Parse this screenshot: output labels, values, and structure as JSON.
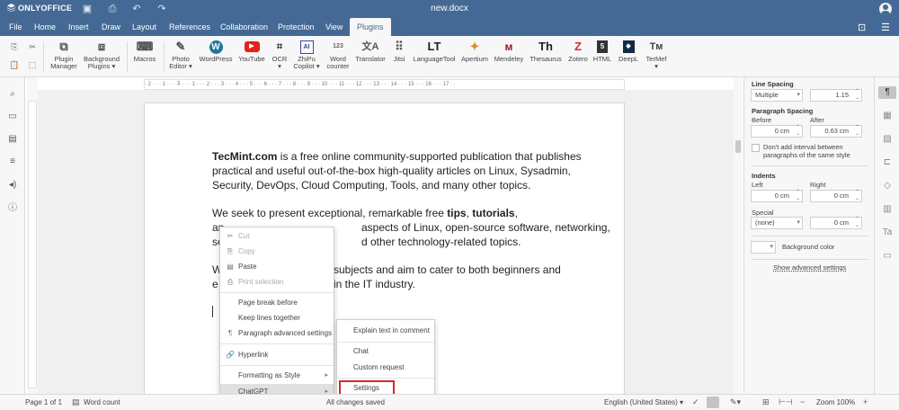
{
  "app": {
    "logo_text": "ONLYOFFICE",
    "doc_title": "new.docx"
  },
  "menu_tabs": [
    "File",
    "Home",
    "Insert",
    "Draw",
    "Layout",
    "References",
    "Collaboration",
    "Protection",
    "View",
    "Plugins"
  ],
  "active_tab": "Plugins",
  "toolbar": {
    "plugin_manager": "Plugin\nManager",
    "plugin_manager_l1": "Plugin",
    "plugin_manager_l2": "Manager",
    "background_plugins_l1": "Background",
    "background_plugins_l2": "Plugins ▾",
    "macros": "Macros",
    "photo_editor_l1": "Photo",
    "photo_editor_l2": "Editor ▾",
    "wordpress": "WordPress",
    "youtube": "YouTube",
    "ocr_l1": "OCR",
    "ocr_l2": "▾",
    "zhipu_l1": "ZhiPu",
    "zhipu_l2": "Copilot ▾",
    "word_counter_l1": "Word",
    "word_counter_l2": "counter",
    "translator": "Translator",
    "jitsi": "Jitsi",
    "languagetool": "LanguageTool",
    "apertium": "Apertium",
    "mendeley": "Mendeley",
    "thesaurus": "Thesaurus",
    "zotero": "Zotero",
    "html": "HTML",
    "deepl": "DeepL",
    "termef_l1": "TerMef",
    "termef_l2": "▾"
  },
  "ruler_text": "· 2 · · · 1 · · · ⊼ · · · 1 · · · 2 · · · 3 · · · 4 · · · 5 · · · 6 · · · 7 · · · 8 · · · 9 · · · 10 · · · 11 · · · 12 · · · 13 · · · 14 · · · 15 · · · 16 · · · 17 · ·",
  "document": {
    "p1_brand": "TecMint.com",
    "p1_rest": " is a free online community-supported publication that publishes practical and useful out-of-the-box high-quality articles on Linux, Sysadmin, Security, DevOps, Cloud Computing, Tools, and many other topics.",
    "p2_a": "We seek to present exceptional, remarkable free ",
    "p2_b1": "tips",
    "p2_c": ", ",
    "p2_b2": "tutorials",
    "p2_d": ",",
    "p2_line2_left": "an",
    "p2_line2_right": "aspects of Linux, open-source software, networking,",
    "p2_line3_left": "se",
    "p2_line3_right": "d other technology-related topics.",
    "p3_line1_left": "W",
    "p3_line1_right": "subjects and aim to cater to both beginners and",
    "p3_line2_left": "e",
    "p3_line2_right": "in the IT industry."
  },
  "context_menu": {
    "cut": "Cut",
    "copy": "Copy",
    "paste": "Paste",
    "print_selection": "Print selection",
    "page_break_before": "Page break before",
    "keep_lines_together": "Keep lines together",
    "paragraph_advanced": "Paragraph advanced settings",
    "hyperlink": "Hyperlink",
    "formatting_as_style": "Formatting as Style",
    "chatgpt": "ChatGPT"
  },
  "submenu": {
    "explain": "Explain text in comment",
    "chat": "Chat",
    "custom_request": "Custom request",
    "settings": "Settings"
  },
  "right_panel": {
    "line_spacing_title": "Line Spacing",
    "line_spacing_mode": "Multiple",
    "line_spacing_value": "1.15",
    "paragraph_spacing_title": "Paragraph Spacing",
    "before_label": "Before",
    "after_label": "After",
    "before_value": "0 cm",
    "after_value": "0.63 cm",
    "dont_add_interval": "Don't add interval between paragraphs of the same style",
    "dont_add_l1": "Don't add interval between",
    "dont_add_l2": "paragraphs of the same style",
    "indents_title": "Indents",
    "left_label": "Left",
    "right_label": "Right",
    "left_value": "0 cm",
    "right_value": "0 cm",
    "special_label": "Special",
    "special_value": "(none)",
    "special_amount": "0 cm",
    "background_color": "Background color",
    "show_advanced": "Show advanced settings"
  },
  "status_bar": {
    "page": "Page 1 of 1",
    "word_count": "Word count",
    "saved": "All changes saved",
    "language": "English (United States)",
    "zoom": "Zoom 100%"
  },
  "colors": {
    "header": "#446995",
    "highlight_box": "#d9262c",
    "youtube": "#e62117",
    "zotero": "#cc2936",
    "mendeley": "#9d1620"
  }
}
